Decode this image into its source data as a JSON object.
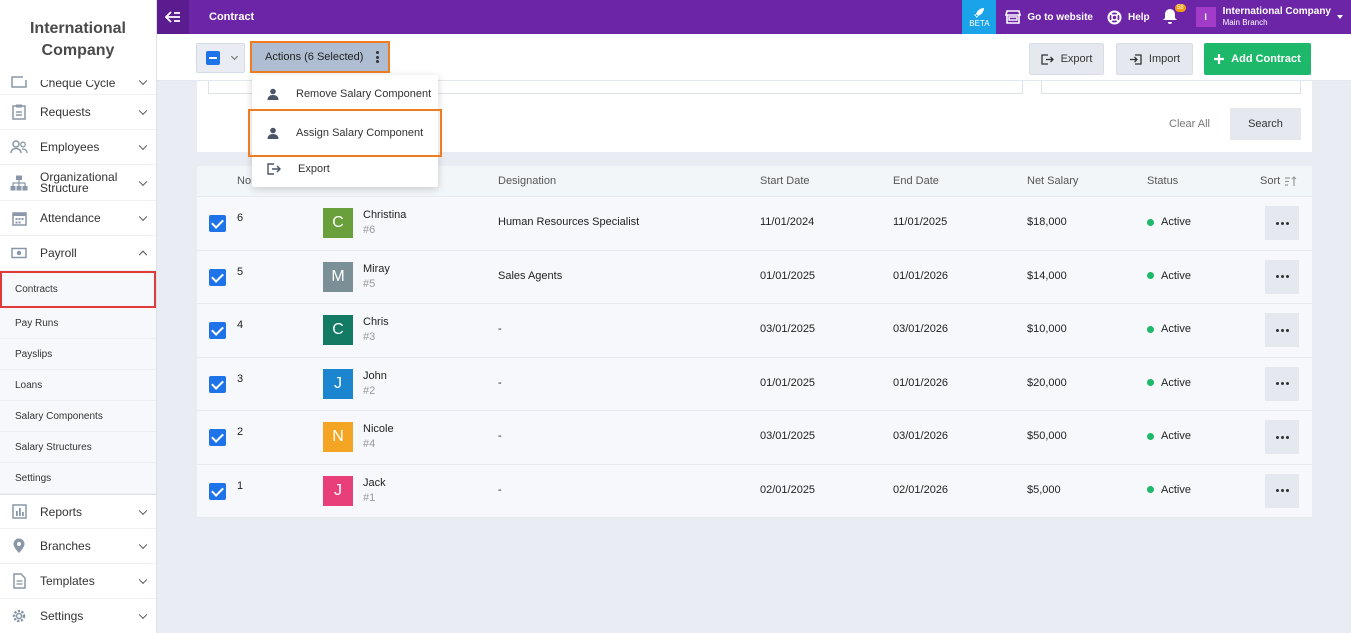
{
  "sidebar": {
    "brand": "International Company",
    "items": [
      {
        "label": "Cheque Cycle",
        "icon": "cheque-icon"
      },
      {
        "label": "Requests",
        "icon": "clipboard-icon"
      },
      {
        "label": "Employees",
        "icon": "users-icon"
      },
      {
        "label": "Organizational Structure",
        "icon": "org-chart-icon"
      },
      {
        "label": "Attendance",
        "icon": "calendar-icon"
      },
      {
        "label": "Payroll",
        "icon": "money-icon"
      }
    ],
    "payroll_sub": [
      "Contracts",
      "Pay Runs",
      "Payslips",
      "Loans",
      "Salary Components",
      "Salary Structures",
      "Settings"
    ],
    "bottom_items": [
      {
        "label": "Reports",
        "icon": "chart-icon"
      },
      {
        "label": "Branches",
        "icon": "location-icon"
      },
      {
        "label": "Templates",
        "icon": "document-icon"
      },
      {
        "label": "Settings",
        "icon": "gear-icon"
      }
    ]
  },
  "topbar": {
    "title": "Contract",
    "beta": "BETA",
    "go_to_website": "Go to website",
    "help": "Help",
    "notif_count": "58",
    "company_initial": "I",
    "company_name": "International Company",
    "branch": "Main Branch"
  },
  "toolbar": {
    "actions_label": "Actions (6 Selected)",
    "export_label": "Export",
    "import_label": "Import",
    "add_label": "Add Contract"
  },
  "filters": {
    "clear_all": "Clear All",
    "search": "Search"
  },
  "dropdown": {
    "items": [
      "Remove Salary Component",
      "Assign Salary Component",
      "Export"
    ]
  },
  "table": {
    "headers": {
      "no": "No.",
      "designation": "Designation",
      "start": "Start Date",
      "end": "End Date",
      "salary": "Net Salary",
      "status": "Status",
      "sort": "Sort"
    },
    "rows": [
      {
        "no": "6",
        "initial": "C",
        "color": "#6aa03c",
        "name": "Christina",
        "id": "#6",
        "designation": "Human Resources Specialist",
        "start": "11/01/2024",
        "end": "11/01/2025",
        "salary": "$18,000",
        "status": "Active"
      },
      {
        "no": "5",
        "initial": "M",
        "color": "#7b8f96",
        "name": "Miray",
        "id": "#5",
        "designation": "Sales Agents",
        "start": "01/01/2025",
        "end": "01/01/2026",
        "salary": "$14,000",
        "status": "Active"
      },
      {
        "no": "4",
        "initial": "C",
        "color": "#137a63",
        "name": "Chris",
        "id": "#3",
        "designation": "-",
        "start": "03/01/2025",
        "end": "03/01/2026",
        "salary": "$10,000",
        "status": "Active"
      },
      {
        "no": "3",
        "initial": "J",
        "color": "#1b85cf",
        "name": "John",
        "id": "#2",
        "designation": "-",
        "start": "01/01/2025",
        "end": "01/01/2026",
        "salary": "$20,000",
        "status": "Active"
      },
      {
        "no": "2",
        "initial": "N",
        "color": "#f5a524",
        "name": "Nicole",
        "id": "#4",
        "designation": "-",
        "start": "03/01/2025",
        "end": "03/01/2026",
        "salary": "$50,000",
        "status": "Active"
      },
      {
        "no": "1",
        "initial": "J",
        "color": "#e83e7a",
        "name": "Jack",
        "id": "#1",
        "designation": "-",
        "start": "02/01/2025",
        "end": "02/01/2026",
        "salary": "$5,000",
        "status": "Active"
      }
    ]
  }
}
